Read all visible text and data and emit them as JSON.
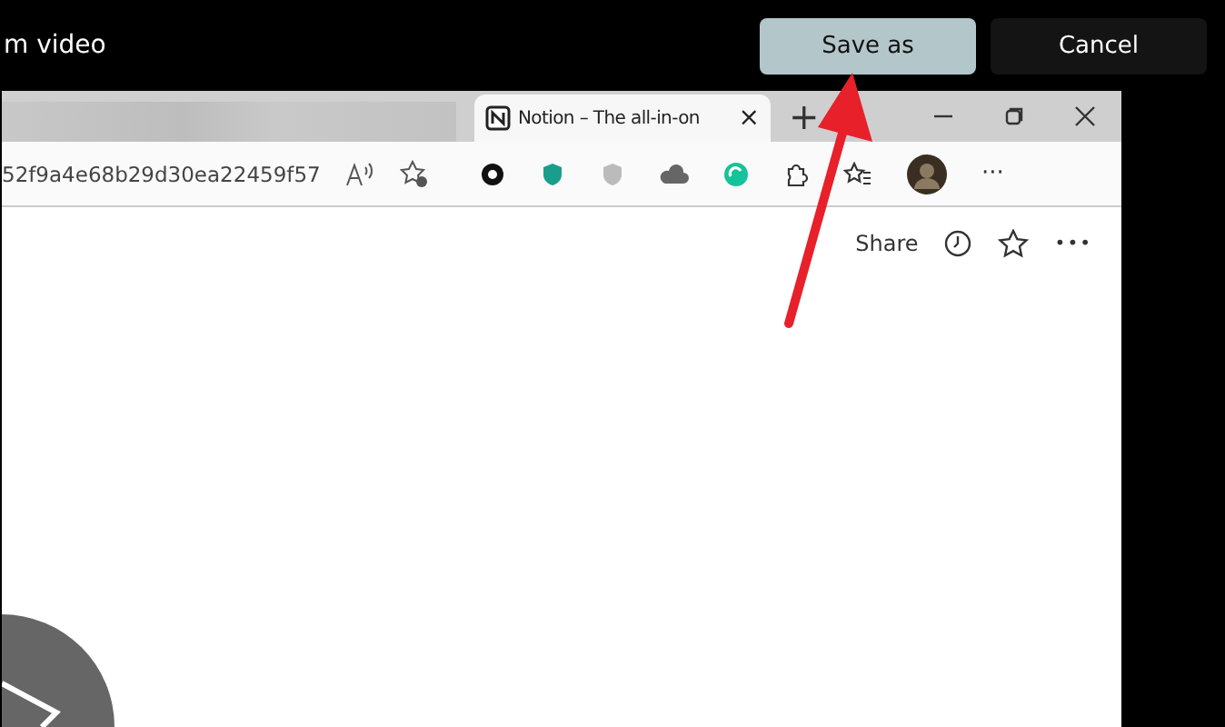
{
  "window": {
    "title": "m video"
  },
  "buttons": [
    {
      "label": "Save as",
      "kind": "primary"
    },
    {
      "label": "Cancel",
      "kind": "secondary"
    }
  ],
  "browser": {
    "tab": {
      "title": "Notion – The all-in-on",
      "close": "×"
    },
    "new_tab": "+",
    "address": "52f9a4e68b29d30ea22459f57",
    "page": {
      "share": "Share",
      "more": "•••"
    },
    "toolbar_more": "···"
  }
}
